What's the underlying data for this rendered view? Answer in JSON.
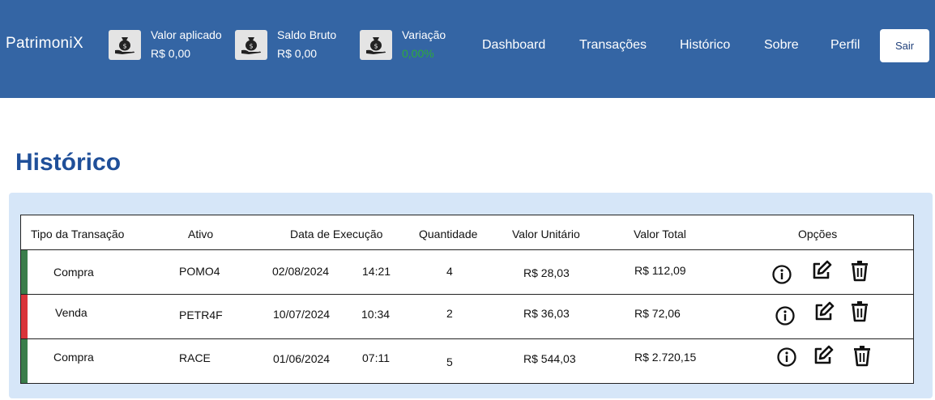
{
  "header": {
    "brand": "PatrimoniX",
    "stats": [
      {
        "label": "Valor aplicado",
        "value": "R$ 0,00",
        "icon": "money-bag-hand-icon"
      },
      {
        "label": "Saldo Bruto",
        "value": "R$ 0,00",
        "icon": "money-bag-hand-icon"
      },
      {
        "label": "Variação",
        "value": "0,00%",
        "icon": "money-bag-hand-icon",
        "value_color": "#2eaa3c"
      }
    ],
    "nav": [
      "Dashboard",
      "Transações",
      "Histórico",
      "Sobre",
      "Perfil"
    ],
    "logout_label": "Sair",
    "background": "#3465a4"
  },
  "page": {
    "title": "Histórico",
    "title_color": "#1f4f99"
  },
  "table": {
    "columns": [
      "Tipo  da Transação",
      "Ativo",
      "Data de  Execução",
      "Quantidade",
      "Valor Unitário",
      "Valor Total",
      "Opções"
    ],
    "rows": [
      {
        "type": "Compra",
        "asset": "POMO4",
        "date": "02/08/2024",
        "time": "14:21",
        "quantity": "4",
        "unit_value": "R$ 28,03",
        "total": "R$ 112,09",
        "stripe_color": "#3a7d4a"
      },
      {
        "type": "Venda",
        "asset": "PETR4F",
        "date": "10/07/2024",
        "time": "10:34",
        "quantity": "2",
        "unit_value": "R$ 36,03",
        "total": "R$ 72,06",
        "stripe_color": "#d9343a"
      },
      {
        "type": "Compra",
        "asset": "RACE",
        "date": "01/06/2024",
        "time": "07:11",
        "quantity": "5",
        "unit_value": "R$ 544,03",
        "total": "R$ 2.720,15",
        "stripe_color": "#3a7d4a"
      }
    ],
    "actions": [
      "info-icon",
      "edit-icon",
      "trash-icon"
    ]
  }
}
